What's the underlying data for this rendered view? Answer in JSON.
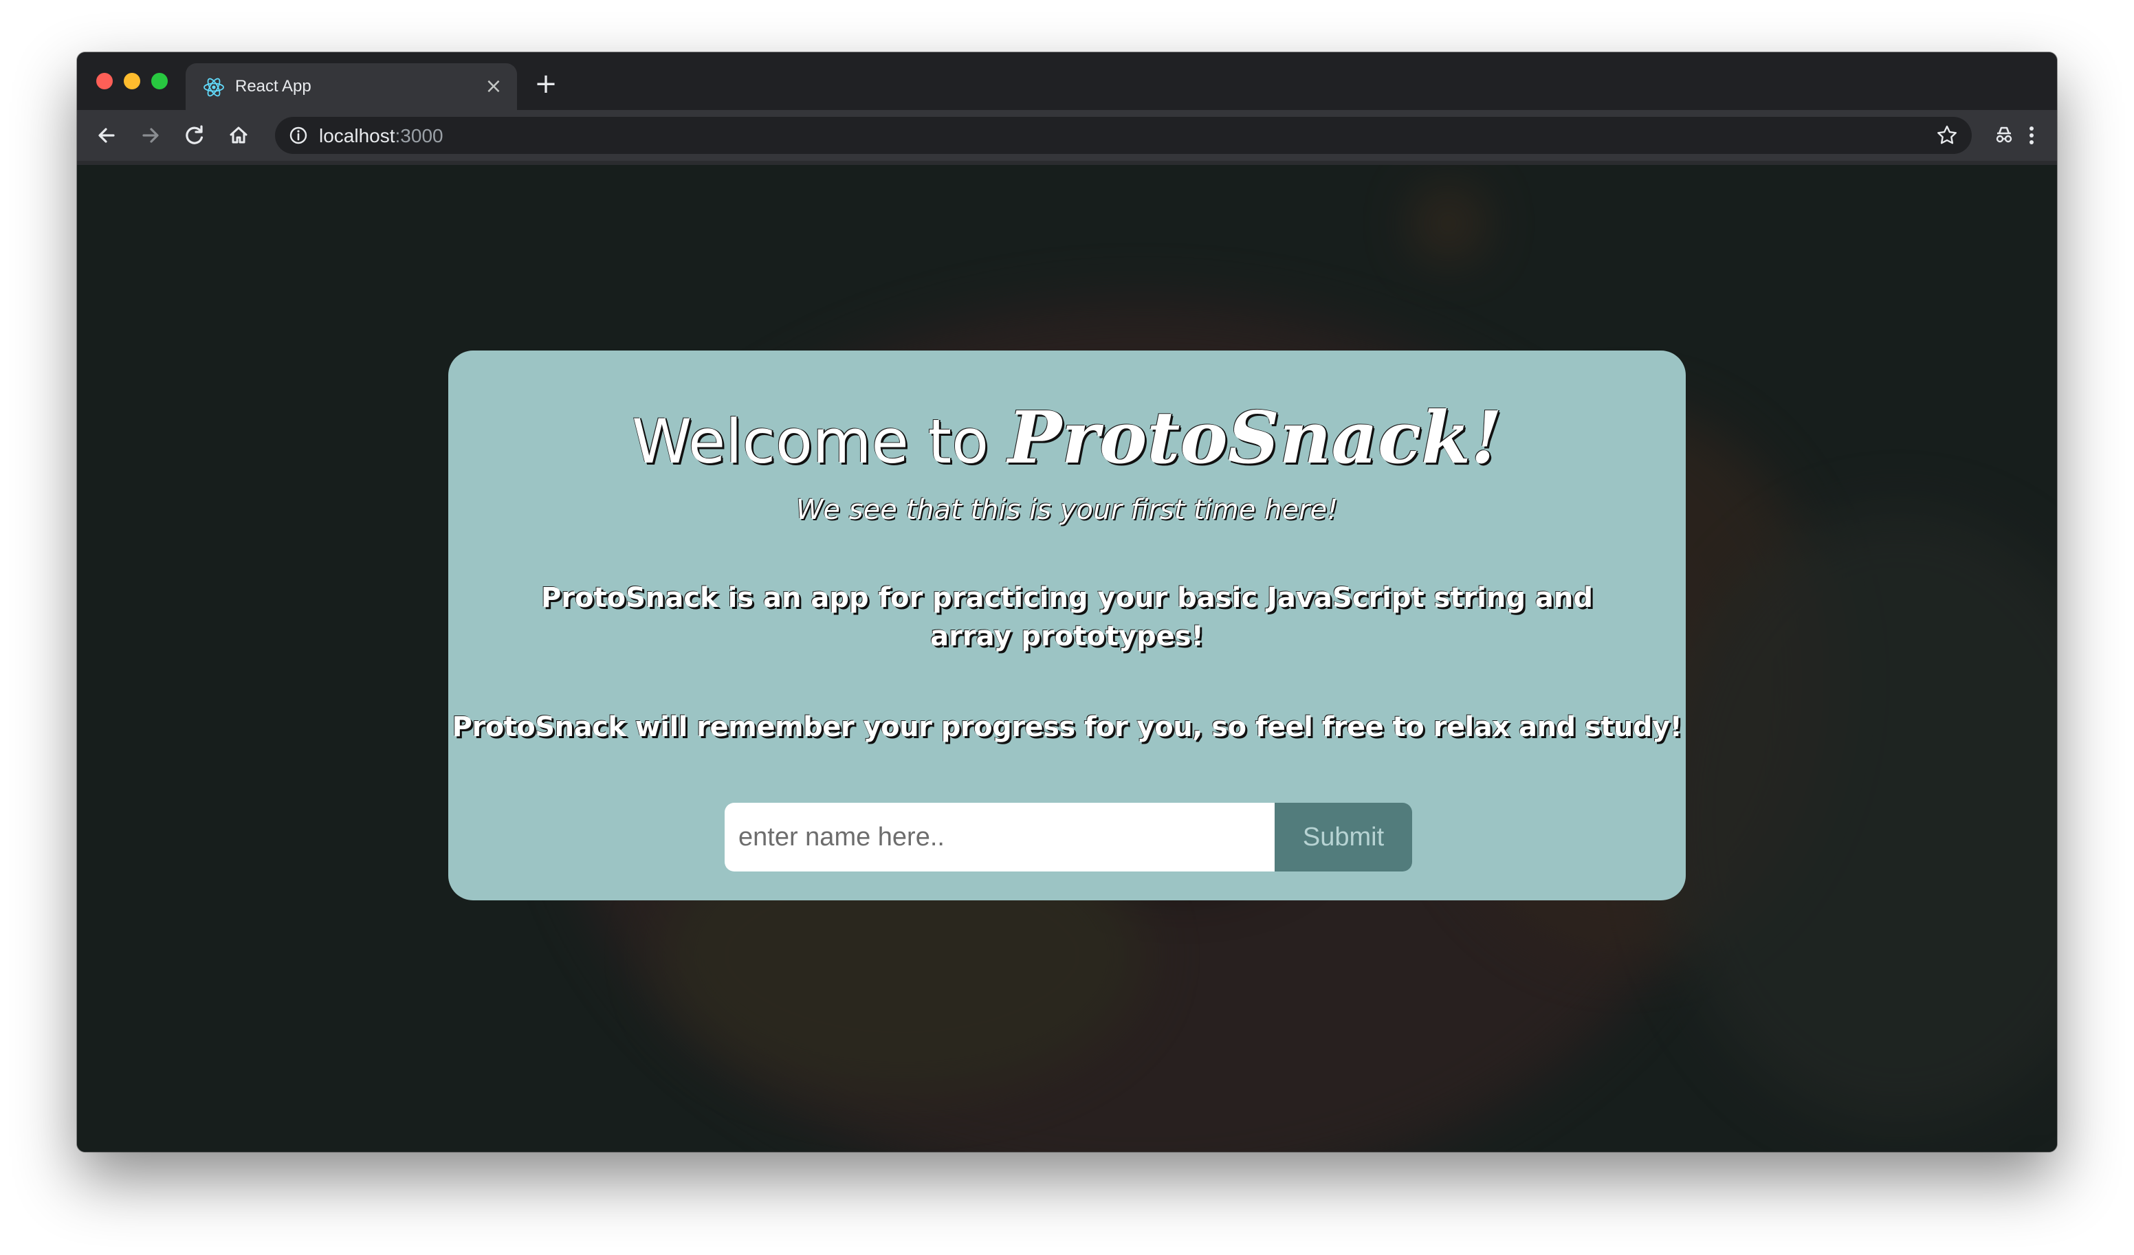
{
  "browser": {
    "tab_title": "React App",
    "url_host": "localhost",
    "url_port": ":3000",
    "icons": {
      "close": "close-icon",
      "new_tab": "plus-icon",
      "back": "arrow-left-icon",
      "forward": "arrow-right-icon",
      "reload": "reload-icon",
      "home": "home-icon",
      "info": "info-icon",
      "bookmark": "star-icon",
      "incognito": "incognito-icon",
      "menu": "kebab-menu-icon"
    },
    "new_tab_glyph": "+",
    "close_glyph": "×"
  },
  "page": {
    "welcome_prefix": "Welcome to ",
    "brand": "ProtoSnack!",
    "subtitle": "We see that this is your first time here!",
    "paragraph1": "ProtoSnack is an app for practicing your basic JavaScript string and array prototypes!",
    "paragraph2": "ProtoSnack will remember your progress for you, so feel free to relax and study!",
    "name_input_placeholder": "enter name here..",
    "name_input_value": "",
    "submit_label": "Submit"
  },
  "colors": {
    "card_bg": "#9cc4c4",
    "submit_bg": "#527c7c",
    "submit_text": "#b7d3d3",
    "browser_frame": "#202124",
    "toolbar": "#35363a"
  }
}
